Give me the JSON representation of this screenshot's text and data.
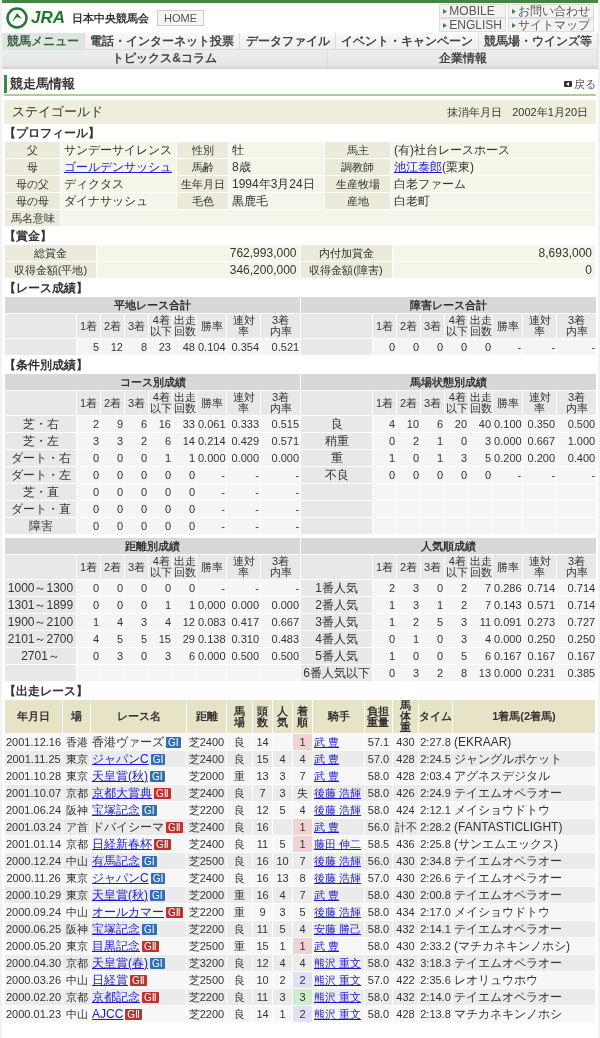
{
  "header": {
    "logo": "JRA",
    "org": "日本中央競馬会",
    "home": "HOME",
    "links": [
      "MOBILE",
      "お問い合わせ",
      "ENGLISH",
      "サイトマップ"
    ]
  },
  "nav": [
    {
      "label": "競馬メニュー",
      "selected": true
    },
    {
      "label": "電話・インターネット投票",
      "selected": false
    },
    {
      "label": "データファイル",
      "selected": false
    },
    {
      "label": "イベント・キャンペーン",
      "selected": false
    },
    {
      "label": "競馬場・ウインズ等",
      "selected": false
    },
    {
      "label": "トピックス&コラム",
      "selected": false
    },
    {
      "label": "企業情報",
      "selected": false
    }
  ],
  "page_title": "競走馬情報",
  "back": "戻る",
  "horse": {
    "name": "ステイゴールド",
    "retired_label": "抹消年月日",
    "retired_date": "2002年1月20日"
  },
  "profile": {
    "title": "【プロフィール】",
    "rows": [
      {
        "cells": [
          {
            "label": "父",
            "value": {
              "text": "サンデーサイレンス",
              "link": false
            }
          },
          {
            "label": "性別",
            "value": {
              "text": "牡",
              "link": false
            }
          },
          {
            "label": "馬主",
            "value": {
              "text": "(有)社台レースホース",
              "link": false
            }
          }
        ]
      },
      {
        "cells": [
          {
            "label": "母",
            "value": {
              "text": "ゴールデンサッシュ",
              "link": true
            }
          },
          {
            "label": "馬齢",
            "value": {
              "text": "8歳",
              "link": false
            }
          },
          {
            "label": "調教師",
            "value": {
              "text": "池江泰郎",
              "link": true,
              "after": "(栗東)"
            }
          }
        ]
      },
      {
        "cells": [
          {
            "label": "母の父",
            "value": {
              "text": "ディクタス",
              "link": false
            }
          },
          {
            "label": "生年月日",
            "value": {
              "text": "1994年3月24日",
              "link": false
            }
          },
          {
            "label": "生産牧場",
            "value": {
              "text": "白老ファーム",
              "link": false
            }
          }
        ]
      },
      {
        "cells": [
          {
            "label": "母の母",
            "value": {
              "text": "ダイナサッシュ",
              "link": false
            }
          },
          {
            "label": "毛色",
            "value": {
              "text": "黒鹿毛",
              "link": false
            }
          },
          {
            "label": "産地",
            "value": {
              "text": "白老町",
              "link": false
            }
          }
        ]
      },
      {
        "cells": [
          {
            "label": "馬名意味"
          }
        ]
      }
    ]
  },
  "prize": {
    "title": "【賞金】",
    "rows": [
      {
        "cells": [
          {
            "label": "総賞金",
            "value": "762,993,000"
          },
          {
            "label": "内付加賞金",
            "value": "8,693,000"
          }
        ]
      },
      {
        "cells": [
          {
            "label": "収得金額(平地)",
            "value": "346,200,000"
          },
          {
            "label": "収得金額(障害)",
            "value": "0"
          }
        ]
      }
    ]
  },
  "race_record": {
    "title": "【レース成績】",
    "tables": [
      {
        "halves": [
          {
            "title": "平地レース合計",
            "columns": [
              "1着",
              "2着",
              "3着",
              "4着以下",
              "出走回数",
              "勝率",
              "連対率",
              "3着内率"
            ],
            "rows": [
              {
                "values": [
                  "5",
                  "12",
                  "8",
                  "23",
                  "48",
                  "0.104",
                  "0.354",
                  "0.521"
                ]
              }
            ]
          },
          {
            "title": "障害レース合計",
            "columns": [
              "1着",
              "2着",
              "3着",
              "4着以下",
              "出走回数",
              "勝率",
              "連対率",
              "3着内率"
            ],
            "rows": [
              {
                "values": [
                  "0",
                  "0",
                  "0",
                  "0",
                  "0",
                  "-",
                  "-",
                  "-"
                ]
              }
            ]
          }
        ]
      }
    ]
  },
  "condition_record": {
    "title": "【条件別成績】",
    "tables": [
      {
        "halves": [
          {
            "title": "コース別成績",
            "columns": [
              "1着",
              "2着",
              "3着",
              "4着以下",
              "出走回数",
              "勝率",
              "連対率",
              "3着内率"
            ],
            "rows": [
              {
                "label": "芝・右",
                "values": [
                  "2",
                  "9",
                  "6",
                  "16",
                  "33",
                  "0.061",
                  "0.333",
                  "0.515"
                ]
              },
              {
                "label": "芝・左",
                "values": [
                  "3",
                  "3",
                  "2",
                  "6",
                  "14",
                  "0.214",
                  "0.429",
                  "0.571"
                ]
              },
              {
                "label": "ダート・右",
                "values": [
                  "0",
                  "0",
                  "0",
                  "1",
                  "1",
                  "0.000",
                  "0.000",
                  "0.000"
                ]
              },
              {
                "label": "ダート・左",
                "values": [
                  "0",
                  "0",
                  "0",
                  "0",
                  "0",
                  "-",
                  "-",
                  "-"
                ]
              },
              {
                "label": "芝・直",
                "values": [
                  "0",
                  "0",
                  "0",
                  "0",
                  "0",
                  "-",
                  "-",
                  "-"
                ]
              },
              {
                "label": "ダート・直",
                "values": [
                  "0",
                  "0",
                  "0",
                  "0",
                  "0",
                  "-",
                  "-",
                  "-"
                ]
              },
              {
                "label": "障害",
                "values": [
                  "0",
                  "0",
                  "0",
                  "0",
                  "0",
                  "-",
                  "-",
                  "-"
                ]
              }
            ]
          },
          {
            "title": "馬場状態別成績",
            "columns": [
              "1着",
              "2着",
              "3着",
              "4着以下",
              "出走回数",
              "勝率",
              "連対率",
              "3着内率"
            ],
            "rows": [
              {
                "label": "良",
                "values": [
                  "4",
                  "10",
                  "6",
                  "20",
                  "40",
                  "0.100",
                  "0.350",
                  "0.500"
                ]
              },
              {
                "label": "稍重",
                "values": [
                  "0",
                  "2",
                  "1",
                  "0",
                  "3",
                  "0.000",
                  "0.667",
                  "1.000"
                ]
              },
              {
                "label": "重",
                "values": [
                  "1",
                  "0",
                  "1",
                  "3",
                  "5",
                  "0.200",
                  "0.200",
                  "0.400"
                ]
              },
              {
                "label": "不良",
                "values": [
                  "0",
                  "0",
                  "0",
                  "0",
                  "0",
                  "-",
                  "-",
                  "-"
                ]
              }
            ]
          }
        ]
      },
      {
        "halves": [
          {
            "title": "距離別成績",
            "columns": [
              "1着",
              "2着",
              "3着",
              "4着以下",
              "出走回数",
              "勝率",
              "連対率",
              "3着内率"
            ],
            "rows": [
              {
                "label": "1000～1300",
                "values": [
                  "0",
                  "0",
                  "0",
                  "0",
                  "0",
                  "-",
                  "-",
                  "-"
                ]
              },
              {
                "label": "1301～1899",
                "values": [
                  "0",
                  "0",
                  "0",
                  "1",
                  "1",
                  "0.000",
                  "0.000",
                  "0.000"
                ]
              },
              {
                "label": "1900～2100",
                "values": [
                  "1",
                  "4",
                  "3",
                  "4",
                  "12",
                  "0.083",
                  "0.417",
                  "0.667"
                ]
              },
              {
                "label": "2101～2700",
                "values": [
                  "4",
                  "5",
                  "5",
                  "15",
                  "29",
                  "0.138",
                  "0.310",
                  "0.483"
                ]
              },
              {
                "label": "2701～",
                "values": [
                  "0",
                  "3",
                  "0",
                  "3",
                  "6",
                  "0.000",
                  "0.500",
                  "0.500"
                ]
              }
            ]
          },
          {
            "title": "人気順成績",
            "columns": [
              "1着",
              "2着",
              "3着",
              "4着以下",
              "出走回数",
              "勝率",
              "連対率",
              "3着内率"
            ],
            "rows": [
              {
                "label": "1番人気",
                "values": [
                  "2",
                  "3",
                  "0",
                  "2",
                  "7",
                  "0.286",
                  "0.714",
                  "0.714"
                ]
              },
              {
                "label": "2番人気",
                "values": [
                  "1",
                  "3",
                  "1",
                  "2",
                  "7",
                  "0.143",
                  "0.571",
                  "0.714"
                ]
              },
              {
                "label": "3番人気",
                "values": [
                  "1",
                  "2",
                  "5",
                  "3",
                  "11",
                  "0.091",
                  "0.273",
                  "0.727"
                ]
              },
              {
                "label": "4番人気",
                "values": [
                  "0",
                  "1",
                  "0",
                  "3",
                  "4",
                  "0.000",
                  "0.250",
                  "0.250"
                ]
              },
              {
                "label": "5番人気",
                "values": [
                  "1",
                  "0",
                  "0",
                  "5",
                  "6",
                  "0.167",
                  "0.167",
                  "0.167"
                ]
              },
              {
                "label": "6番人気以下",
                "values": [
                  "0",
                  "3",
                  "2",
                  "8",
                  "13",
                  "0.000",
                  "0.231",
                  "0.385"
                ]
              }
            ]
          }
        ]
      }
    ]
  },
  "races": {
    "title": "【出走レース】",
    "columns": [
      "年月日",
      "場",
      "レース名",
      "距離",
      "馬場",
      "頭数",
      "人気",
      "着順",
      "騎手",
      "負担重量",
      "馬体重",
      "タイム",
      "1着馬(2着馬)"
    ],
    "rows": [
      {
        "date": "2001.12.16",
        "venue": "香港",
        "race": {
          "name": "香港ヴァーズ",
          "link": false,
          "grade": {
            "label": "GⅠ",
            "color": "#2f6fb8"
          }
        },
        "distance": "芝2400",
        "going": "良",
        "runners": "14",
        "finish": {
          "text": "1",
          "color": "#f2d3d3"
        },
        "jockey": "武 豊",
        "weight": "57.1",
        "body_weight": "430",
        "time": "2:27.8",
        "winner": "(EKRAAR)"
      },
      {
        "date": "2001.11.25",
        "venue": "東京",
        "race": {
          "name": "ジャパンC",
          "link": true,
          "grade": {
            "label": "GⅠ",
            "color": "#2f6fb8"
          }
        },
        "distance": "芝2400",
        "going": "良",
        "runners": "15",
        "popularity": "4",
        "finish": {
          "text": "4"
        },
        "jockey": "武 豊",
        "weight": "57.0",
        "body_weight": "428",
        "time": "2:24.5",
        "winner": "ジャングルポケット"
      },
      {
        "date": "2001.10.28",
        "venue": "東京",
        "race": {
          "name": "天皇賞(秋)",
          "link": true,
          "grade": {
            "label": "GⅠ",
            "color": "#2f6fb8"
          }
        },
        "distance": "芝2000",
        "going": "重",
        "runners": "13",
        "popularity": "3",
        "finish": {
          "text": "7"
        },
        "jockey": "武 豊",
        "weight": "58.0",
        "body_weight": "428",
        "time": "2:03.4",
        "winner": "アグネスデジタル"
      },
      {
        "date": "2001.10.07",
        "venue": "京都",
        "race": {
          "name": "京都大賞典",
          "link": true,
          "grade": {
            "label": "GⅡ",
            "color": "#c0302c"
          }
        },
        "distance": "芝2400",
        "going": "良",
        "runners": "7",
        "popularity": "3",
        "finish": {
          "text": "失"
        },
        "jockey": "後藤 浩輝",
        "weight": "58.0",
        "body_weight": "426",
        "time": "2:24.9",
        "winner": "テイエムオペラオー"
      },
      {
        "date": "2001.06.24",
        "venue": "阪神",
        "race": {
          "name": "宝塚記念",
          "link": true,
          "grade": {
            "label": "GⅠ",
            "color": "#2f6fb8"
          }
        },
        "distance": "芝2200",
        "going": "良",
        "runners": "12",
        "popularity": "5",
        "finish": {
          "text": "4"
        },
        "jockey": "後藤 浩輝",
        "weight": "58.0",
        "body_weight": "424",
        "time": "2:12.1",
        "winner": "メイショウドトウ"
      },
      {
        "date": "2001.03.24",
        "venue": "ア首",
        "race": {
          "name": "ドバイシーマ",
          "link": false,
          "grade": {
            "label": "GⅡ",
            "color": "#c0302c"
          }
        },
        "distance": "芝2400",
        "going": "良",
        "runners": "16",
        "finish": {
          "text": "1",
          "color": "#f2d3d3"
        },
        "jockey": "武 豊",
        "weight": "56.0",
        "body_weight": "計不",
        "time": "2:28.2",
        "winner": "(FANTASTICLIGHT)"
      },
      {
        "date": "2001.01.14",
        "venue": "京都",
        "race": {
          "name": "日経新春杯",
          "link": true,
          "grade": {
            "label": "GⅡ",
            "color": "#c0302c"
          }
        },
        "distance": "芝2400",
        "going": "良",
        "runners": "11",
        "popularity": "5",
        "finish": {
          "text": "1",
          "color": "#f2d3d3"
        },
        "jockey": "藤田 伸二",
        "weight": "58.5",
        "body_weight": "436",
        "time": "2:25.8",
        "winner": "(サンエムエックス)"
      },
      {
        "date": "2000.12.24",
        "venue": "中山",
        "race": {
          "name": "有馬記念",
          "link": true,
          "grade": {
            "label": "GⅠ",
            "color": "#2f6fb8"
          }
        },
        "distance": "芝2500",
        "going": "良",
        "runners": "16",
        "popularity": "10",
        "finish": {
          "text": "7"
        },
        "jockey": "後藤 浩輝",
        "weight": "56.0",
        "body_weight": "430",
        "time": "2:34.8",
        "winner": "テイエムオペラオー"
      },
      {
        "date": "2000.11.26",
        "venue": "東京",
        "race": {
          "name": "ジャパンC",
          "link": true,
          "grade": {
            "label": "GⅠ",
            "color": "#2f6fb8"
          }
        },
        "distance": "芝2400",
        "going": "良",
        "runners": "16",
        "popularity": "13",
        "finish": {
          "text": "8"
        },
        "jockey": "後藤 浩輝",
        "weight": "57.0",
        "body_weight": "430",
        "time": "2:26.6",
        "winner": "テイエムオペラオー"
      },
      {
        "date": "2000.10.29",
        "venue": "東京",
        "race": {
          "name": "天皇賞(秋)",
          "link": true,
          "grade": {
            "label": "GⅠ",
            "color": "#2f6fb8"
          }
        },
        "distance": "芝2000",
        "going": "重",
        "runners": "16",
        "popularity": "4",
        "finish": {
          "text": "7"
        },
        "jockey": "武 豊",
        "weight": "58.0",
        "body_weight": "430",
        "time": "2:00.8",
        "winner": "テイエムオペラオー"
      },
      {
        "date": "2000.09.24",
        "venue": "中山",
        "race": {
          "name": "オールカマー",
          "link": true,
          "grade": {
            "label": "GⅡ",
            "color": "#c0302c"
          }
        },
        "distance": "芝2200",
        "going": "重",
        "runners": "9",
        "popularity": "3",
        "finish": {
          "text": "5"
        },
        "jockey": "後藤 浩輝",
        "weight": "58.0",
        "body_weight": "434",
        "time": "2:17.0",
        "winner": "メイショウドトウ"
      },
      {
        "date": "2000.06.25",
        "venue": "阪神",
        "race": {
          "name": "宝塚記念",
          "link": true,
          "grade": {
            "label": "GⅠ",
            "color": "#2f6fb8"
          }
        },
        "distance": "芝2200",
        "going": "良",
        "runners": "11",
        "popularity": "5",
        "finish": {
          "text": "4"
        },
        "jockey": "安藤 勝己",
        "weight": "58.0",
        "body_weight": "432",
        "time": "2:14.1",
        "winner": "テイエムオペラオー"
      },
      {
        "date": "2000.05.20",
        "venue": "東京",
        "race": {
          "name": "目黒記念",
          "link": true,
          "grade": {
            "label": "GⅡ",
            "color": "#c0302c"
          }
        },
        "distance": "芝2500",
        "going": "重",
        "runners": "15",
        "popularity": "1",
        "finish": {
          "text": "1",
          "color": "#f2d3d3"
        },
        "jockey": "武 豊",
        "weight": "58.0",
        "body_weight": "430",
        "time": "2:33.2",
        "winner": "(マチカネキンノホシ)"
      },
      {
        "date": "2000.04.30",
        "venue": "京都",
        "race": {
          "name": "天皇賞(春)",
          "link": true,
          "grade": {
            "label": "GⅠ",
            "color": "#2f6fb8"
          }
        },
        "distance": "芝3200",
        "going": "良",
        "runners": "12",
        "popularity": "4",
        "finish": {
          "text": "4"
        },
        "jockey": "熊沢 重文",
        "weight": "58.0",
        "body_weight": "432",
        "time": "3:18.3",
        "winner": "テイエムオペラオー"
      },
      {
        "date": "2000.03.26",
        "venue": "中山",
        "race": {
          "name": "日経賞",
          "link": true,
          "grade": {
            "label": "GⅡ",
            "color": "#c0302c"
          }
        },
        "distance": "芝2500",
        "going": "良",
        "runners": "10",
        "popularity": "2",
        "finish": {
          "text": "2",
          "color": "#e2e0f5"
        },
        "jockey": "熊沢 重文",
        "weight": "57.0",
        "body_weight": "422",
        "time": "2:35.6",
        "winner": "レオリュウホウ"
      },
      {
        "date": "2000.02.20",
        "venue": "京都",
        "race": {
          "name": "京都記念",
          "link": true,
          "grade": {
            "label": "GⅡ",
            "color": "#c0302c"
          }
        },
        "distance": "芝2200",
        "going": "良",
        "runners": "11",
        "popularity": "3",
        "finish": {
          "text": "3",
          "color": "#cdeecd"
        },
        "jockey": "熊沢 重文",
        "weight": "58.0",
        "body_weight": "432",
        "time": "2:14.0",
        "winner": "テイエムオペラオー"
      },
      {
        "date": "2000.01.23",
        "venue": "中山",
        "race": {
          "name": "AJCC",
          "link": true,
          "grade": {
            "label": "GⅡ",
            "color": "#c0302c"
          }
        },
        "distance": "芝2200",
        "going": "良",
        "runners": "14",
        "popularity": "1",
        "finish": {
          "text": "2",
          "color": "#e2e0f5"
        },
        "jockey": "熊沢 重文",
        "weight": "58.0",
        "body_weight": "428",
        "time": "2:13.8",
        "winner": "マチカネキンノホシ"
      }
    ]
  }
}
